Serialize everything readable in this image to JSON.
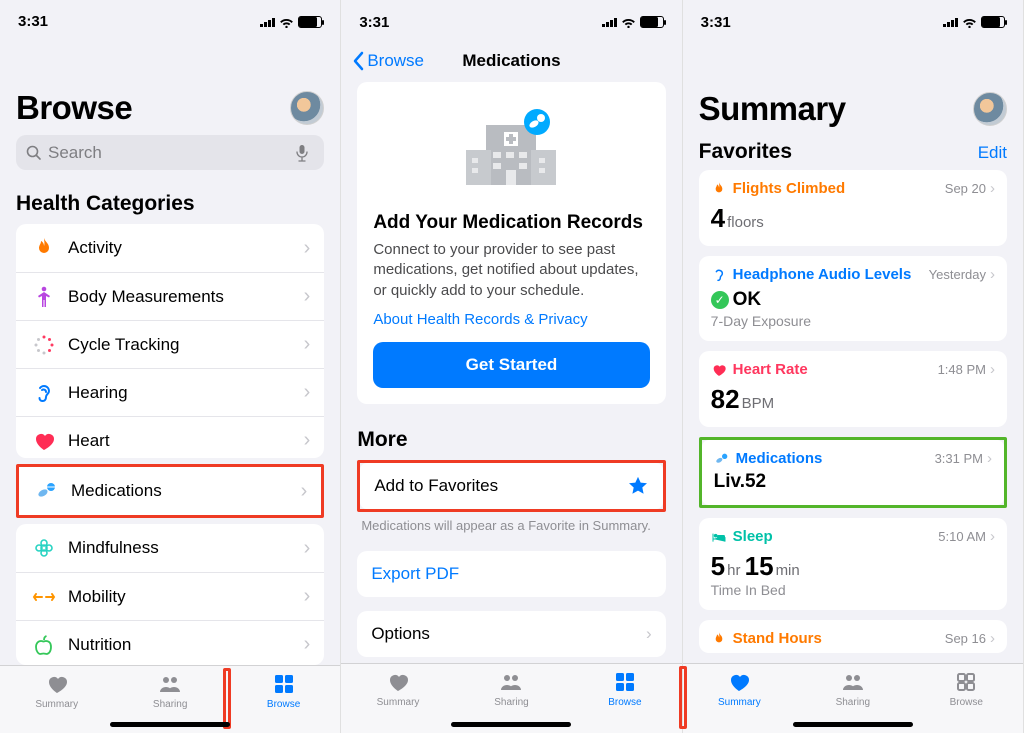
{
  "status": {
    "time": "3:31"
  },
  "left": {
    "title": "Browse",
    "search_placeholder": "Search",
    "section": "Health Categories",
    "categories": [
      "Activity",
      "Body Measurements",
      "Cycle Tracking",
      "Hearing",
      "Heart",
      "Medications",
      "Mindfulness",
      "Mobility",
      "Nutrition"
    ]
  },
  "center": {
    "back": "Browse",
    "title": "Medications",
    "card_title": "Add Your Medication Records",
    "card_body": "Connect to your provider to see past medications, get notified about updates, or quickly add to your schedule.",
    "card_link": "About Health Records & Privacy",
    "card_button": "Get Started",
    "more": "More",
    "fav_label": "Add to Favorites",
    "fav_hint": "Medications will appear as a Favorite in Summary.",
    "export": "Export PDF",
    "options": "Options"
  },
  "right": {
    "title": "Summary",
    "favorites_label": "Favorites",
    "edit": "Edit",
    "cards": {
      "flights": {
        "title": "Flights Climbed",
        "when": "Sep 20",
        "value": "4",
        "unit": "floors"
      },
      "headphone": {
        "title": "Headphone Audio Levels",
        "when": "Yesterday",
        "value": "OK",
        "sub": "7-Day Exposure"
      },
      "heart": {
        "title": "Heart Rate",
        "when": "1:48 PM",
        "value": "82",
        "unit": "BPM"
      },
      "meds": {
        "title": "Medications",
        "when": "3:31 PM",
        "value": "Liv.52"
      },
      "sleep": {
        "title": "Sleep",
        "when": "5:10 AM",
        "v1": "5",
        "u1": "hr",
        "v2": "15",
        "u2": "min",
        "sub": "Time In Bed"
      },
      "stand": {
        "title": "Stand Hours",
        "when": "Sep 16"
      }
    }
  },
  "tabs": {
    "summary": "Summary",
    "sharing": "Sharing",
    "browse": "Browse"
  }
}
